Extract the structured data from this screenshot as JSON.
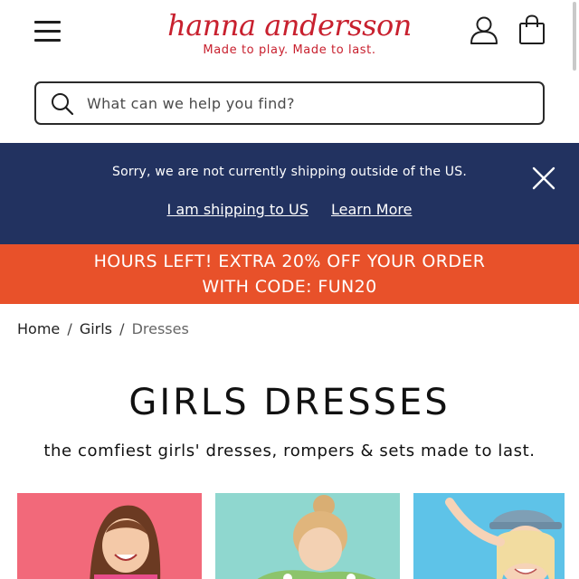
{
  "header": {
    "logo_text": "hanna andersson",
    "tagline": "Made to play. Made to last.",
    "menu_icon": "hamburger-menu-icon",
    "account_icon": "person-icon",
    "bag_icon": "shopping-bag-icon"
  },
  "search": {
    "placeholder": "What can we help you find?",
    "value": ""
  },
  "shipping_banner": {
    "message": "Sorry, we are not currently shipping outside of the US.",
    "link_us": "I am shipping to US",
    "link_learn": "Learn More",
    "close_icon": "close-icon"
  },
  "promo": {
    "line1": "HOURS LEFT! EXTRA 20% OFF YOUR ORDER",
    "line2": "WITH CODE: FUN20"
  },
  "breadcrumb": {
    "home": "Home",
    "girls": "Girls",
    "current": "Dresses"
  },
  "page": {
    "title": "GIRLS DRESSES",
    "subtitle": "the comfiest girls' dresses, rompers & sets made to last."
  },
  "colors": {
    "brand_red": "#c8202e",
    "banner_navy": "#223260",
    "promo_orange": "#e8512a"
  }
}
